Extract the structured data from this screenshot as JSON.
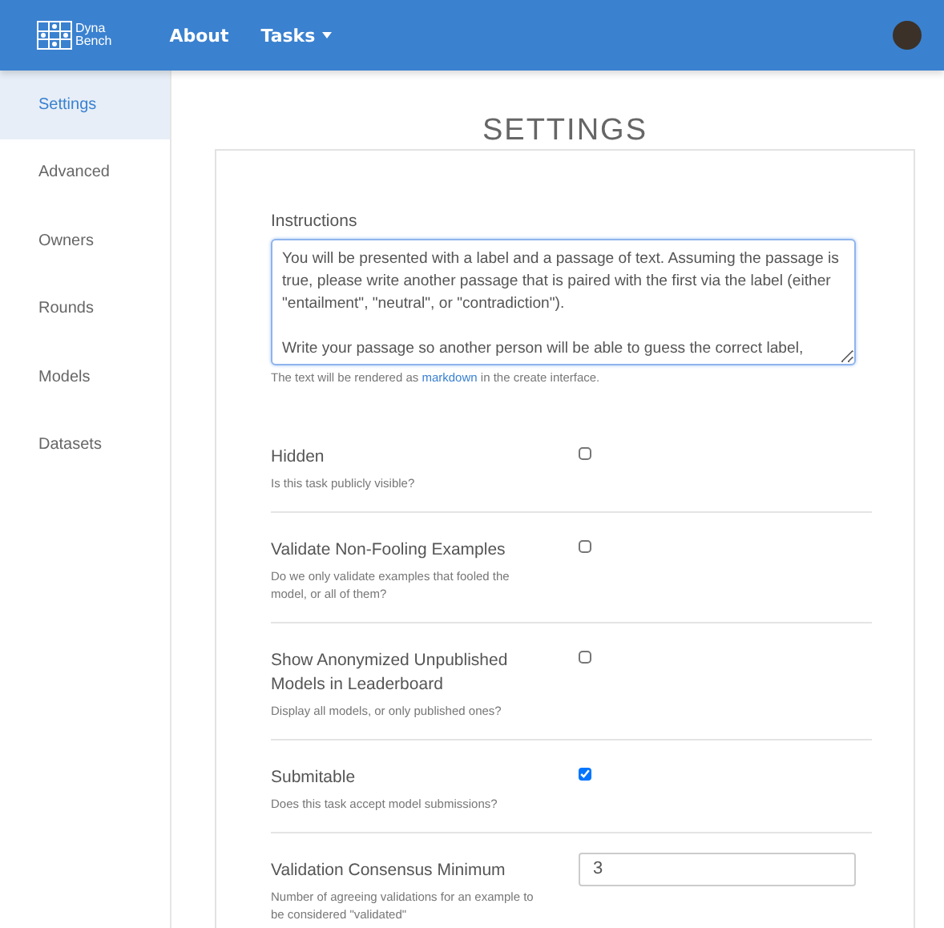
{
  "navbar": {
    "logo": [
      "Dyna",
      "Bench"
    ],
    "links": [
      {
        "label": "About",
        "kind": "link"
      },
      {
        "label": "Tasks",
        "kind": "dropdown"
      }
    ]
  },
  "sidebar": {
    "items": [
      {
        "label": "Settings",
        "selected": true
      },
      {
        "label": "Advanced",
        "selected": false
      },
      {
        "label": "Owners",
        "selected": false
      },
      {
        "label": "Rounds",
        "selected": false
      },
      {
        "label": "Models",
        "selected": false
      },
      {
        "label": "Datasets",
        "selected": false
      }
    ]
  },
  "page_title": "SETTINGS",
  "instructions": {
    "label": "Instructions",
    "value": "You will be presented with a label and a passage of text. Assuming the passage is true, please write another passage that is paired with the first via the label (either \"entailment\", \"neutral\", or \"contradiction\").\n\nWrite your passage so another person will be able to guess the correct label,",
    "help_before": "The text will be rendered as",
    "help_link": "markdown",
    "help_after": "in the create interface."
  },
  "settings": [
    {
      "kind": "checkbox",
      "label": "Hidden",
      "description": "Is this task publicly visible?",
      "checked": false
    },
    {
      "kind": "checkbox",
      "label": "Validate Non-Fooling Examples",
      "description": "Do we only validate examples that fooled the model, or all of them?",
      "checked": false
    },
    {
      "kind": "checkbox",
      "label": "Show Anonymized Unpublished Models in Leaderboard",
      "description": "Display all models, or only published ones?",
      "checked": false
    },
    {
      "kind": "checkbox",
      "label": "Submitable",
      "description": "Does this task accept model submissions?",
      "checked": true
    },
    {
      "kind": "number",
      "label": "Validation Consensus Minimum",
      "description": "Number of agreeing validations for an example to be considered \"validated\"",
      "value": "3"
    }
  ]
}
